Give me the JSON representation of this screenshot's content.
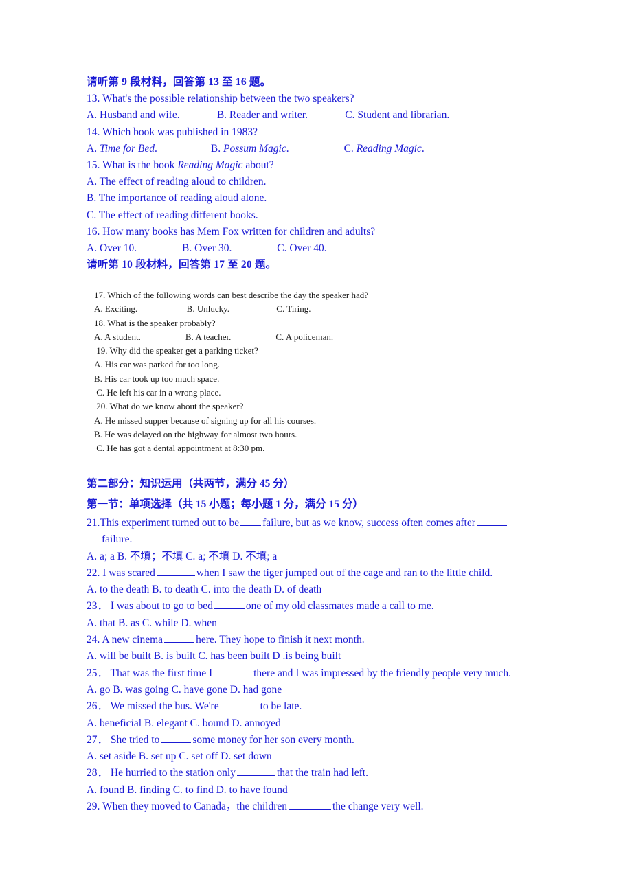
{
  "document": {
    "title": "English Exam Paper - Listening and Grammar Section",
    "text_color_blue": "#1b1bd4",
    "text_color_black": "#1a1a1a",
    "background": "#ffffff"
  },
  "listening_9": {
    "heading": "请听第 9 段材料，回答第 13 至 16 题。",
    "q13": "13. What's the possible relationship between the two speakers?",
    "q13_opts": "A. Husband and wife.              B. Reader and writer.              C. Student and librarian.",
    "q14": "14. Which book was published in 1983?",
    "q14_opt_a_prefix": "A. ",
    "q14_opt_a_title": "Time for Bed",
    "q14_opt_a_suffix": ".",
    "q14_opt_b_prefix": "B. ",
    "q14_opt_b_title": "Possum Magic",
    "q14_opt_b_suffix": ".",
    "q14_opt_c_prefix": "C. ",
    "q14_opt_c_title": "Reading Magic",
    "q14_opt_c_suffix": ".",
    "q15_prefix": "15. What is the book ",
    "q15_title": "Reading Magic",
    "q15_suffix": " about?",
    "q15_opt_a": "A. The effect of reading aloud to children.",
    "q15_opt_b": "B. The importance of reading aloud alone.",
    "q15_opt_c": "C. The effect of reading different books.",
    "q16": "16. How many books has Mem Fox written for children and adults?",
    "q16_opts": "A. Over 10.                 B. Over 30.                 C. Over 40."
  },
  "listening_10": {
    "heading": "请听第 10 段材料，回答第 17 至 20 题。",
    "q17": "17. Which of the following words can best describe the day the speaker had?",
    "q17_opts": "A. Exciting.                      B. Unlucky.                     C. Tiring.",
    "q18": "18. What is the speaker probably?",
    "q18_opts": "A. A student.                    B. A teacher.                    C. A policeman.",
    "q19": " 19. Why did the speaker get a parking ticket?",
    "q19_opt_a": "A. His car was parked for too long.",
    "q19_opt_b": "B. His car took up too much space.",
    "q19_opt_c": " C. He left his car in a wrong place.",
    "q20": " 20. What do we know about the speaker?",
    "q20_opt_a": "A. He missed supper because of signing up for all his courses.",
    "q20_opt_b": "B. He was delayed on the highway for almost two hours.",
    "q20_opt_c": " C. He has got a dental appointment at 8:30 pm."
  },
  "part_two": {
    "heading": "第二部分：知识运用（共两节，满分 45 分）",
    "section_one_heading": "第一节：单项选择（共 15 小题；每小题 1 分，满分 15 分）",
    "questions": [
      {
        "num": "21.",
        "stem_1": "This experiment turned out to be",
        "stem_2": "failure, but as we know, success often comes after",
        "stem_3": "",
        "continuation": "failure.",
        "opts": "     A. a; a                B. 不填；不填          C. a; 不填         D. 不填; a"
      },
      {
        "num": "22.",
        "stem_1": " I was scared",
        "stem_2": "when I saw the tiger jumped out of the cage and ran to the little child.",
        "opts": "   A. to the death        B. to death      C. into the death         D. of death"
      },
      {
        "num": "23．",
        "stem_1": " I was about to go to bed",
        "stem_2": "one of my old classmates made a call to me.",
        "opts": "    A. that  B. as       C. while        D. when"
      },
      {
        "num": "24.",
        "stem_1": " A new cinema",
        "stem_2": "here. They hope to finish it next month.",
        "opts": "     A. will be built        B. is built                    C. has been built     D .is being built"
      },
      {
        "num": "25．",
        "stem_1": " That was the first time I",
        "stem_2": "there and I was impressed by the friendly people very much.",
        "opts": "   A. go     B. was going       C. have gone       D. had gone"
      },
      {
        "num": "26．",
        "stem_1": " We missed the bus. We're",
        "stem_2": "to be late.",
        "opts": "   A. beneficial        B. elegant        C. bound    D. annoyed"
      },
      {
        "num": "27．",
        "stem_1": " She tried to",
        "stem_2": "some money for her son every month.",
        "opts": "   A. set aside        B. set up        C. set off      D. set down"
      },
      {
        "num": "28．",
        "stem_1": " He hurried to the station only",
        "stem_2": "that the train had left.",
        "opts": "   A. found        B. finding      C. to find      D. to have found"
      },
      {
        "num": "29.",
        "stem_1": " When they moved to Canada，the children",
        "stem_2": "the change very well.",
        "opts": ""
      }
    ]
  }
}
